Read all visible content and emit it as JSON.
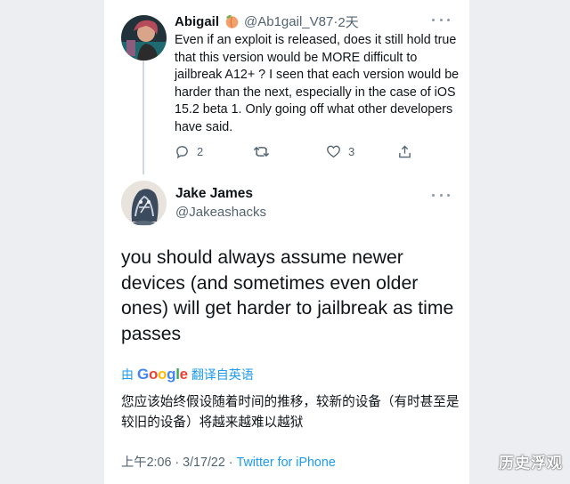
{
  "reply_tweet": {
    "display_name": "Abigail",
    "name_emoji": "peach-emoji",
    "handle": "@Ab1gail_V87",
    "separator": "·",
    "time": "2天",
    "text": "Even if an exploit is released, does it still hold true that this version would be MORE difficult to jailbreak A12+ ? I seen that each version would be harder than the next, especially in the case of iOS 15.2 beta 1. Only going off what other developers have said.",
    "actions": {
      "reply_count": "2",
      "retweet_count": "",
      "like_count": "3"
    }
  },
  "main_tweet": {
    "display_name": "Jake James",
    "verified_glyph": "",
    "handle": "@Jakeashacks",
    "text": "you should always assume newer devices (and sometimes even older ones) will get harder to jailbreak as time passes",
    "translate_prefix": "由",
    "translate_brand": "Google",
    "translate_suffix": "翻译自英语",
    "translated_text": "您应该始终假设随着时间的推移，较新的设备（有时甚至是较旧的设备）将越来越难以越狱",
    "timestamp": "上午2:06 · 3/17/22 · ",
    "source": "Twitter for iPhone"
  },
  "watermark": "历史浮观",
  "colors": {
    "link": "#1d9bf0",
    "muted": "#536471",
    "text": "#0f1419",
    "background": "#eceef1"
  }
}
